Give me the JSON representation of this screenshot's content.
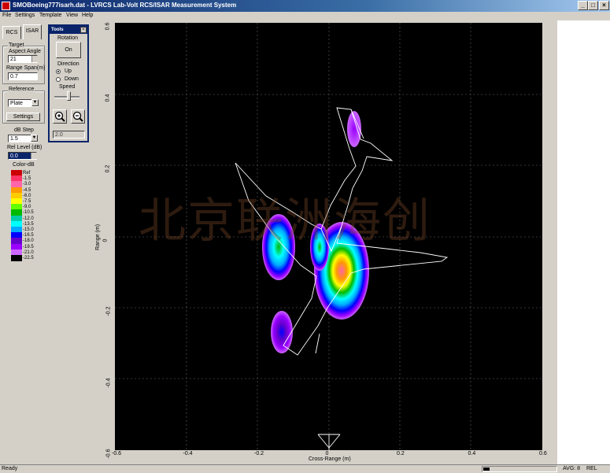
{
  "window": {
    "title": "SMOBoeing777isarh.dat - LVRCS Lab-Volt RCS/ISAR Measurement System",
    "minimize": "_",
    "maximize": "□",
    "close": "×"
  },
  "menu": [
    "File",
    "Settings",
    "Template",
    "View",
    "Help"
  ],
  "tabs": [
    "RCS",
    "ISAR"
  ],
  "target": {
    "group_label": "Target",
    "aspect_label": "Aspect Angle",
    "aspect_value": "21",
    "range_span_label": "Range Span(m)",
    "range_span_value": "0.7"
  },
  "reference": {
    "group_label": "Reference",
    "select_value": "Plate",
    "settings_button": "Settings"
  },
  "display": {
    "db_step_label": "dB Step",
    "db_step_value": "1.5",
    "rel_level_label": "Rel Level (dB)",
    "rel_level_value": "0.0",
    "color_db_label": "Color-dB"
  },
  "legend": [
    {
      "label": "Ref",
      "color": "#cc0000"
    },
    {
      "label": "-1.5",
      "color": "#ff3366"
    },
    {
      "label": "-3.0",
      "color": "#ff66aa"
    },
    {
      "label": "-4.5",
      "color": "#ff9900"
    },
    {
      "label": "-6.0",
      "color": "#ffcc00"
    },
    {
      "label": "-7.5",
      "color": "#ffff00"
    },
    {
      "label": "-9.0",
      "color": "#66ff00"
    },
    {
      "label": "-10.5",
      "color": "#00bb00"
    },
    {
      "label": "-12.0",
      "color": "#00ccaa"
    },
    {
      "label": "-13.5",
      "color": "#00ffff"
    },
    {
      "label": "-15.0",
      "color": "#00aaff"
    },
    {
      "label": "-16.5",
      "color": "#0000ff"
    },
    {
      "label": "-18.0",
      "color": "#6600cc"
    },
    {
      "label": "-19.5",
      "color": "#9900ff"
    },
    {
      "label": "-21.0",
      "color": "#cc66ff"
    },
    {
      "label": "-22.5",
      "color": "#000000"
    }
  ],
  "tools": {
    "title": "Tools",
    "rotation_label": "Rotation",
    "on_button": "On",
    "direction_label": "Direction",
    "up_label": "Up",
    "down_label": "Down",
    "direction_selected": "Up",
    "speed_label": "Speed",
    "zoom_value": "2.0"
  },
  "plot": {
    "watermark": "北京联洲海创",
    "y_ticks": [
      "0.6",
      "0.4",
      "0.2",
      "0",
      "-0.2",
      "-0.4",
      "-0.6"
    ],
    "x_ticks": [
      "-0.6",
      "-0.4",
      "-0.2",
      "0",
      "0.2",
      "0.4",
      "0.6"
    ],
    "y_label": "Range (m)",
    "x_label": "Cross-Range (m)"
  },
  "status": {
    "left": "Ready",
    "avg": "AVG: 8",
    "rel": "REL"
  }
}
